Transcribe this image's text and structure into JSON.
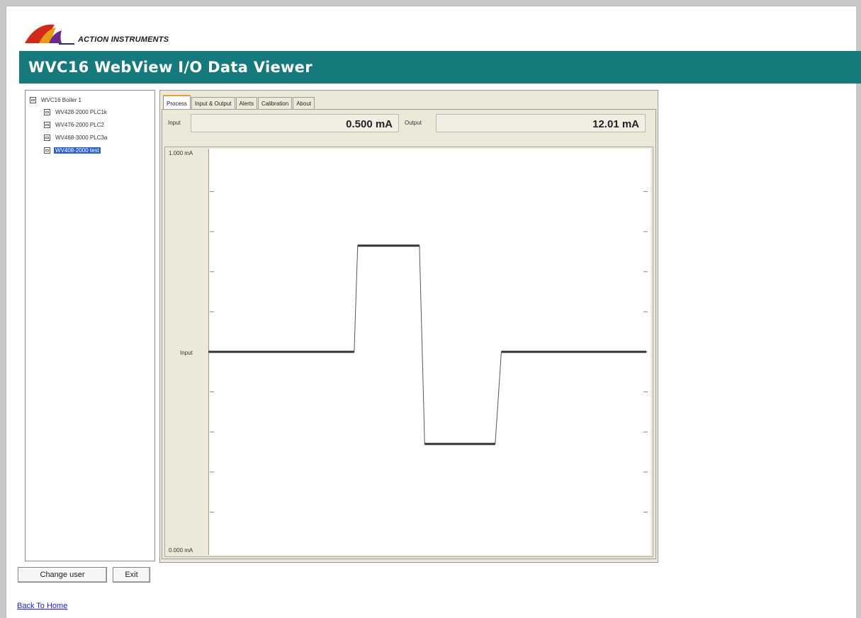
{
  "brand": {
    "logo_text": "ACTION INSTRUMENTS"
  },
  "header": {
    "title": "WVC16 WebView I/O Data Viewer"
  },
  "tree": {
    "root": "WVC16 Boiler 1",
    "items": [
      {
        "label": "WV428-2000 PLC1k",
        "selected": false
      },
      {
        "label": "WV476-2000 PLC2",
        "selected": false
      },
      {
        "label": "WV468-3000 PLC3a",
        "selected": false
      },
      {
        "label": "WV408-2000 test",
        "selected": true
      }
    ]
  },
  "tabs": [
    {
      "label": "Process",
      "active": true
    },
    {
      "label": "Input & Output",
      "active": false
    },
    {
      "label": "Alerts",
      "active": false
    },
    {
      "label": "Calibration",
      "active": false
    },
    {
      "label": "About",
      "active": false
    }
  ],
  "readouts": {
    "input_label": "Input",
    "input_value": "0.500 mA",
    "output_label": "Output",
    "output_value": "12.01 mA"
  },
  "chart_data": {
    "type": "line",
    "y_top_label": "1.000 mA",
    "y_bottom_label": "0.000 mA",
    "series_label": "Input",
    "ylim": [
      0,
      1
    ],
    "xlim": [
      0,
      100
    ],
    "grid": false,
    "series": [
      {
        "x": [
          0,
          33.3,
          34.1,
          48.2,
          49.4,
          65.5,
          66.9,
          100
        ],
        "y": [
          0.5,
          0.5,
          0.765,
          0.765,
          0.27,
          0.27,
          0.5,
          0.5
        ]
      }
    ],
    "colors": {
      "line": "#333333",
      "plot_bg": "#ffffff"
    }
  },
  "buttons": {
    "change_user": "Change user",
    "exit": "Exit"
  },
  "links": {
    "back_to_home": "Back To Home"
  },
  "colors": {
    "titlebar": "#167a7c",
    "selection": "#2c5fc7",
    "tab_accent": "#e8a33c"
  }
}
